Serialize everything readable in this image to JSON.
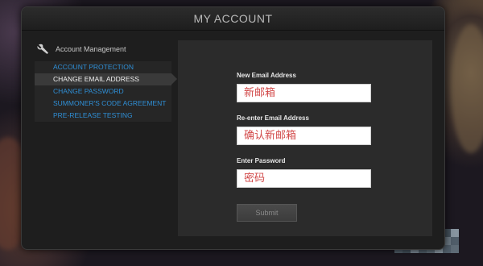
{
  "window": {
    "title": "MY ACCOUNT"
  },
  "sidebar": {
    "header": "Account Management",
    "items": [
      {
        "label": "ACCOUNT PROTECTION",
        "active": false
      },
      {
        "label": "CHANGE EMAIL ADDRESS",
        "active": true
      },
      {
        "label": "CHANGE PASSWORD",
        "active": false
      },
      {
        "label": "SUMMONER'S CODE AGREEMENT",
        "active": false
      },
      {
        "label": "PRE-RELEASE TESTING",
        "active": false
      }
    ]
  },
  "form": {
    "new_email": {
      "label": "New Email Address",
      "placeholder": "新邮箱"
    },
    "confirm_email": {
      "label": "Re-enter Email Address",
      "placeholder": "确认新邮箱"
    },
    "password": {
      "label": "Enter Password",
      "placeholder": "密码"
    },
    "submit_label": "Submit"
  },
  "colors": {
    "link": "#2f8fd6",
    "placeholder_text": "#d24a4a",
    "panel": "#2b2b2b"
  },
  "icons": {
    "sidebar_header": "wrench-icon"
  }
}
